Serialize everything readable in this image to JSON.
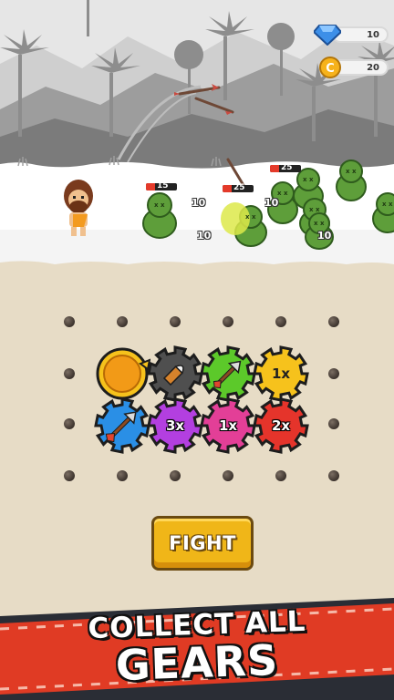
{
  "hud": {
    "gems": "10",
    "coins": "20"
  },
  "enemies": [
    {
      "hp": "15"
    },
    {
      "hp": "25"
    },
    {
      "hp": "25"
    }
  ],
  "damage_numbers": [
    "10",
    "10",
    "10",
    "10"
  ],
  "gears": [
    {
      "id": "gold-coin",
      "label": "",
      "color": "#f29a17"
    },
    {
      "id": "bullet",
      "label": "",
      "color": "#4f4f4f"
    },
    {
      "id": "arrow-green",
      "label": "",
      "color": "#5cc92a"
    },
    {
      "id": "one-x-yellow",
      "label": "1x",
      "color": "#f6c21c"
    },
    {
      "id": "arrow-blue",
      "label": "",
      "color": "#2a8fe6"
    },
    {
      "id": "three-x",
      "label": "3x",
      "color": "#b33fe0"
    },
    {
      "id": "one-x-pink",
      "label": "1x",
      "color": "#e33f97"
    },
    {
      "id": "two-x",
      "label": "2x",
      "color": "#e5342b"
    }
  ],
  "fight_button": "FIGHT",
  "banner": {
    "line1": "COLLECT ALL",
    "line2": "GEARS"
  },
  "colors": {
    "accent": "#f0b618",
    "banner_red": "#e03b24",
    "banner_dark": "#2a2d35"
  }
}
